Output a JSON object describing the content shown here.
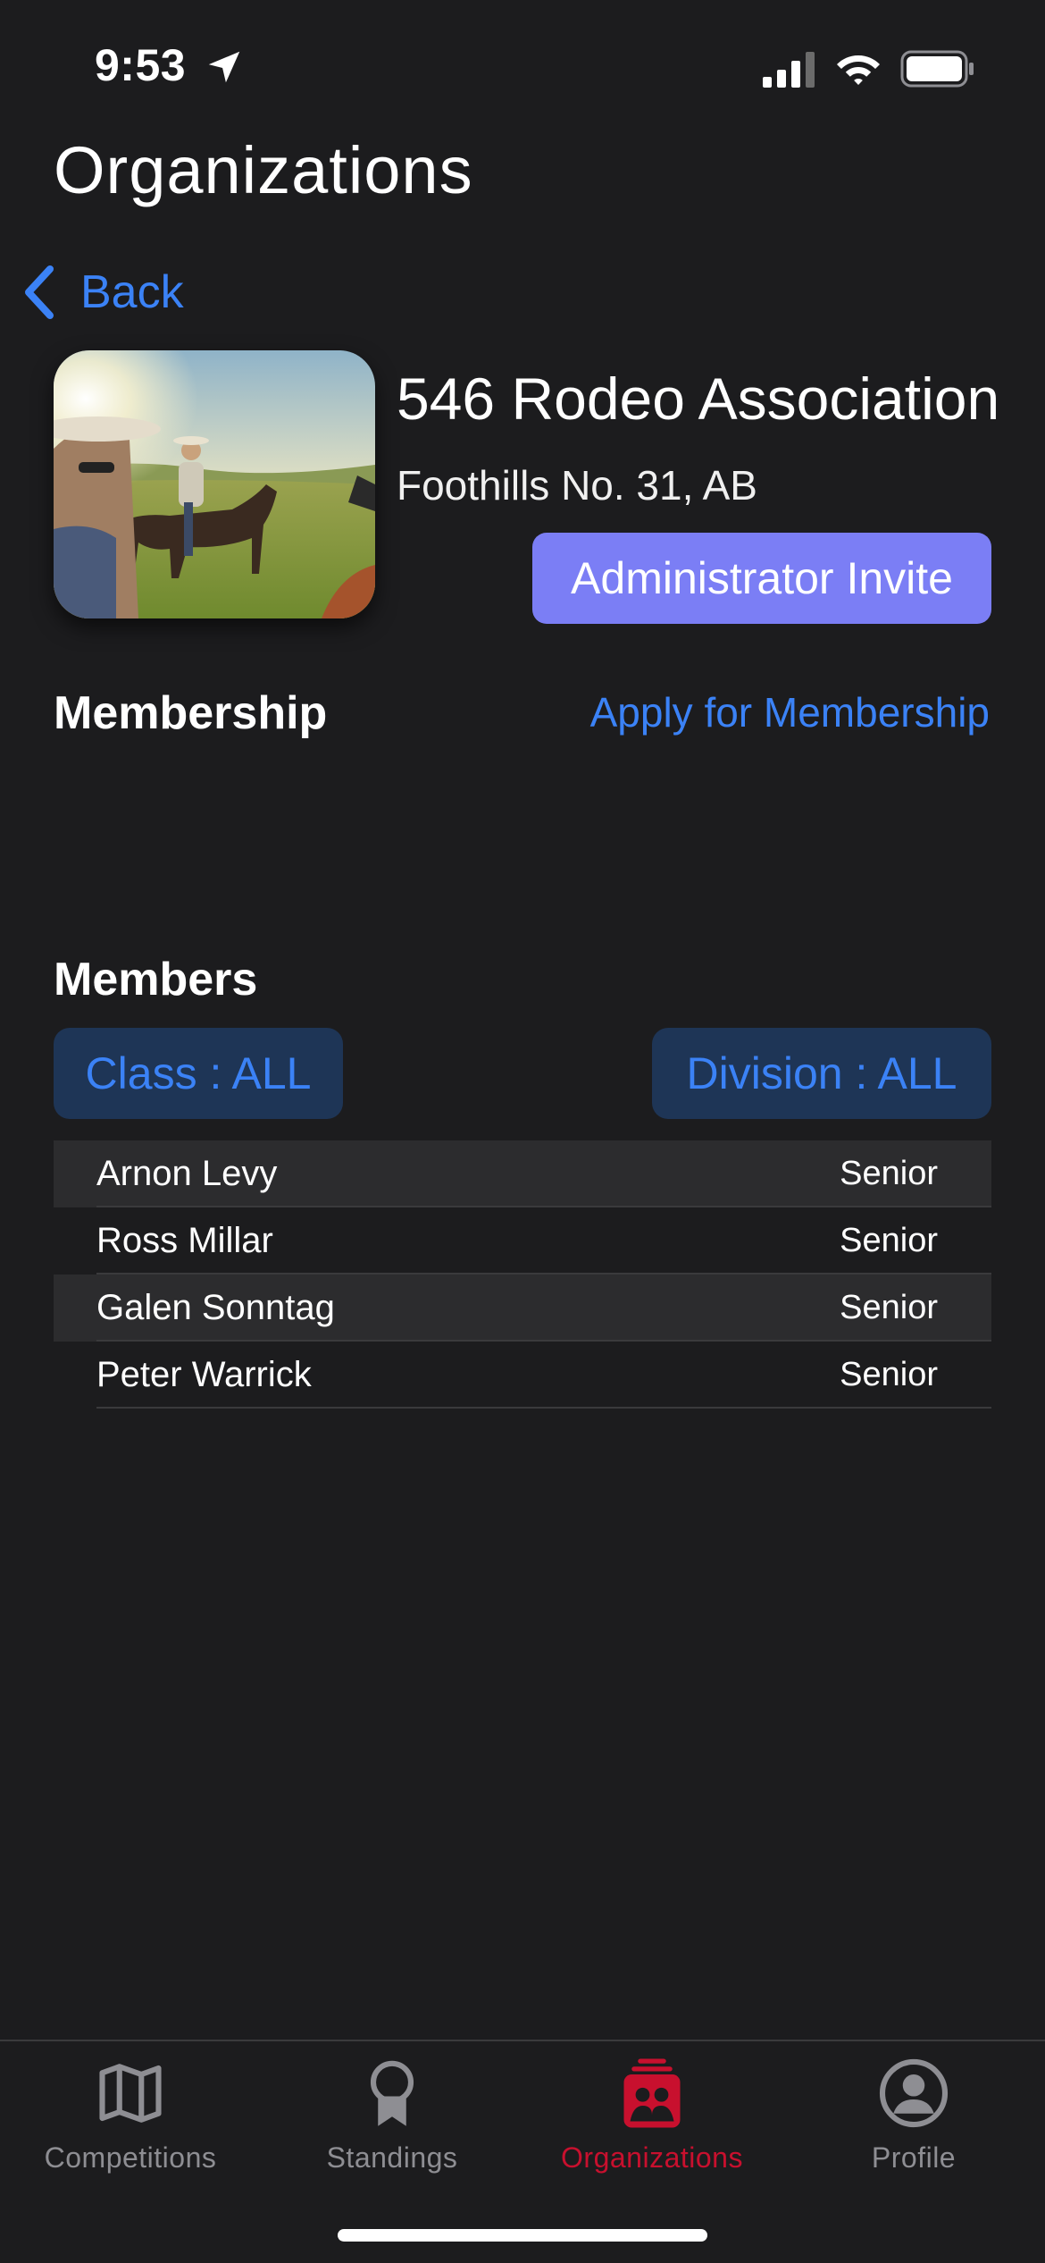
{
  "status_bar": {
    "time": "9:53"
  },
  "header": {
    "title": "Organizations",
    "back_label": "Back"
  },
  "organization": {
    "name": "546 Rodeo Association",
    "location": "Foothills No. 31, AB",
    "admin_button": "Administrator Invite"
  },
  "membership": {
    "heading": "Membership",
    "apply_link": "Apply for Membership"
  },
  "members": {
    "heading": "Members",
    "class_filter": "Class : ALL",
    "division_filter": "Division : ALL",
    "rows": [
      {
        "name": "Arnon Levy",
        "role": "Senior"
      },
      {
        "name": "Ross Millar",
        "role": "Senior"
      },
      {
        "name": "Galen Sonntag",
        "role": "Senior"
      },
      {
        "name": "Peter Warrick",
        "role": "Senior"
      }
    ]
  },
  "tabs": [
    {
      "label": "Competitions",
      "icon": "map-icon"
    },
    {
      "label": "Standings",
      "icon": "ribbon-icon"
    },
    {
      "label": "Organizations",
      "icon": "organizations-icon",
      "active": true
    },
    {
      "label": "Profile",
      "icon": "person-circle-icon"
    }
  ],
  "colors": {
    "accent_blue": "#3b82f6",
    "button_purple": "#7b7ef5",
    "active_red": "#c8102e",
    "background": "#1c1c1e"
  }
}
